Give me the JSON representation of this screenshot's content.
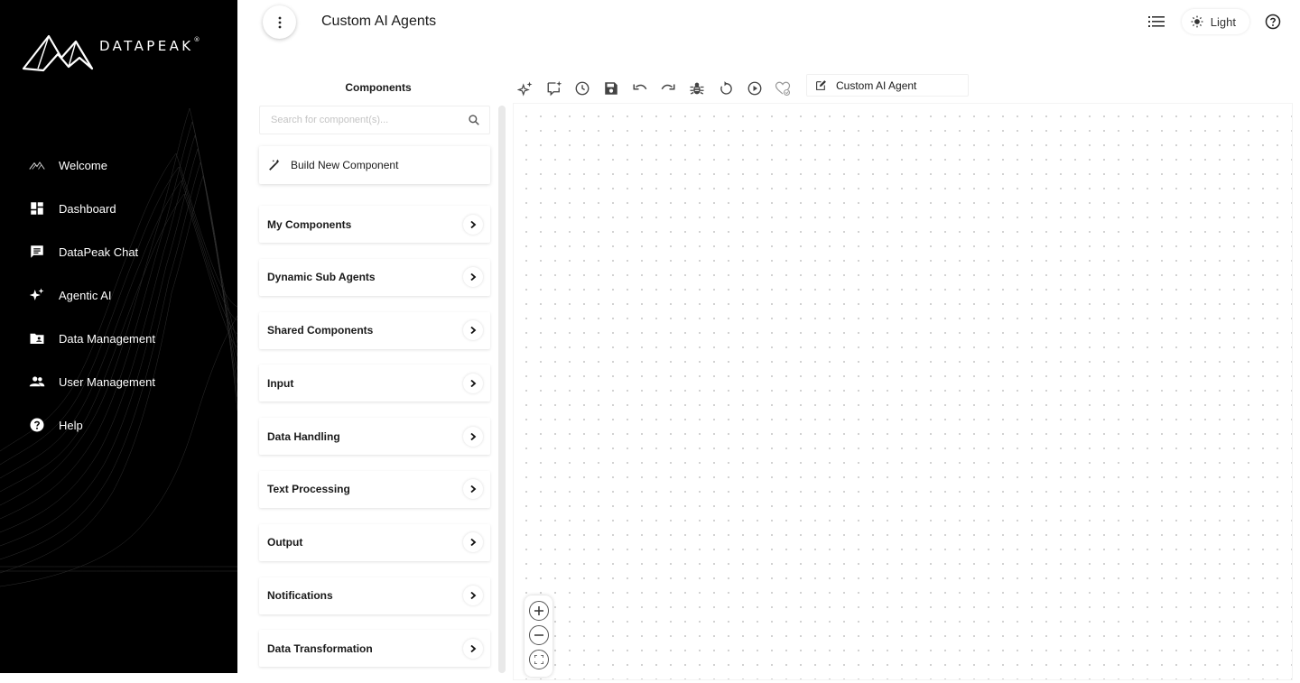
{
  "brand": {
    "name": "DATAPEAK",
    "mark": "®"
  },
  "sidebar": {
    "items": [
      {
        "label": "Welcome",
        "icon": "mountain-icon"
      },
      {
        "label": "Dashboard",
        "icon": "dashboard-icon"
      },
      {
        "label": "DataPeak Chat",
        "icon": "chat-icon"
      },
      {
        "label": "Agentic AI",
        "icon": "sparkle-icon"
      },
      {
        "label": "Data Management",
        "icon": "folder-shared-icon"
      },
      {
        "label": "User Management",
        "icon": "users-icon"
      },
      {
        "label": "Help",
        "icon": "help-icon"
      }
    ]
  },
  "header": {
    "title": "Custom AI Agents",
    "theme_label": "Light"
  },
  "components": {
    "title": "Components",
    "search_placeholder": "Search for component(s)...",
    "build_label": "Build New Component",
    "categories": [
      "My Components",
      "Dynamic Sub Agents",
      "Shared Components",
      "Input",
      "Data Handling",
      "Text Processing",
      "Output",
      "Notifications",
      "Data Transformation"
    ]
  },
  "toolbar": {
    "buttons": [
      "auto-generate-icon",
      "ai-chat-icon",
      "history-icon",
      "save-icon",
      "undo-icon",
      "redo-icon",
      "debug-icon",
      "reset-icon",
      "run-icon",
      "health-icon"
    ],
    "agent_name": "Custom AI Agent"
  },
  "zoom": {
    "buttons": [
      "zoom-in-icon",
      "zoom-out-icon",
      "fit-view-icon"
    ]
  }
}
